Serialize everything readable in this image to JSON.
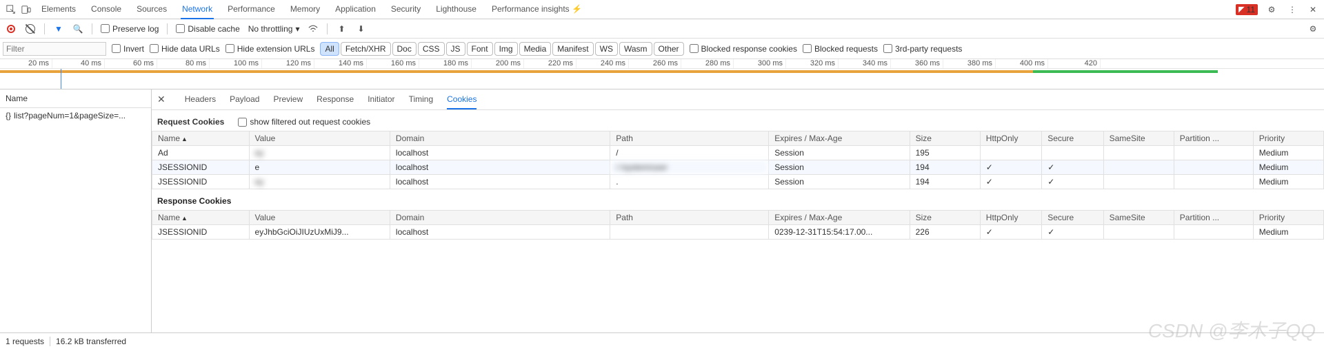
{
  "top_tabs": [
    "Elements",
    "Console",
    "Sources",
    "Network",
    "Performance",
    "Memory",
    "Application",
    "Security",
    "Lighthouse",
    "Performance insights ⚡"
  ],
  "top_active": 3,
  "error_count": "11",
  "toolbar": {
    "preserve_log": "Preserve log",
    "disable_cache": "Disable cache",
    "throttle": "No throttling"
  },
  "filter": {
    "placeholder": "Filter",
    "invert": "Invert",
    "hide_data": "Hide data URLs",
    "hide_ext": "Hide extension URLs",
    "pills": [
      "All",
      "Fetch/XHR",
      "Doc",
      "CSS",
      "JS",
      "Font",
      "Img",
      "Media",
      "Manifest",
      "WS",
      "Wasm",
      "Other"
    ],
    "pill_active": 0,
    "blocked_cookies": "Blocked response cookies",
    "blocked_req": "Blocked requests",
    "third_party": "3rd-party requests"
  },
  "timeline_ticks": [
    "20 ms",
    "40 ms",
    "60 ms",
    "80 ms",
    "100 ms",
    "120 ms",
    "140 ms",
    "160 ms",
    "180 ms",
    "200 ms",
    "220 ms",
    "240 ms",
    "260 ms",
    "280 ms",
    "300 ms",
    "320 ms",
    "340 ms",
    "360 ms",
    "380 ms",
    "400 ms",
    "420"
  ],
  "left": {
    "header": "Name",
    "request": "list?pageNum=1&pageSize=..."
  },
  "detail_tabs": [
    "Headers",
    "Payload",
    "Preview",
    "Response",
    "Initiator",
    "Timing",
    "Cookies"
  ],
  "detail_active": 6,
  "req_cookies_title": "Request Cookies",
  "show_filtered": "show filtered out request cookies",
  "resp_cookies_title": "Response Cookies",
  "cols": [
    "Name",
    "Value",
    "Domain",
    "Path",
    "Expires / Max-Age",
    "Size",
    "HttpOnly",
    "Secure",
    "SameSite",
    "Partition ...",
    "Priority"
  ],
  "req_rows": [
    {
      "name": "Ad",
      "value": "ey",
      "domain": "localhost",
      "path": "/",
      "expires": "Session",
      "size": "195",
      "http": "",
      "secure": "",
      "samesite": "",
      "part": "",
      "prio": "Medium",
      "blur": true
    },
    {
      "name": "JSESSIONID",
      "value": "e",
      "domain": "localhost",
      "path": "/        /system/user",
      "expires": "Session",
      "size": "194",
      "http": "✓",
      "secure": "✓",
      "samesite": "",
      "part": "",
      "prio": "Medium",
      "blur": true
    },
    {
      "name": "JSESSIONID",
      "value": "ey",
      "domain": "localhost",
      "path": ".",
      "expires": "Session",
      "size": "194",
      "http": "✓",
      "secure": "✓",
      "samesite": "",
      "part": "",
      "prio": "Medium",
      "blur": true
    }
  ],
  "resp_rows": [
    {
      "name": "JSESSIONID",
      "value": "eyJhbGciOiJIUzUxMiJ9...",
      "domain": "localhost",
      "path": "",
      "expires": "0239-12-31T15:54:17.00...",
      "size": "226",
      "http": "✓",
      "secure": "✓",
      "samesite": "",
      "part": "",
      "prio": "Medium"
    }
  ],
  "status": {
    "requests": "1 requests",
    "transferred": "16.2 kB transferred"
  },
  "watermark": "CSDN @李木子QQ"
}
